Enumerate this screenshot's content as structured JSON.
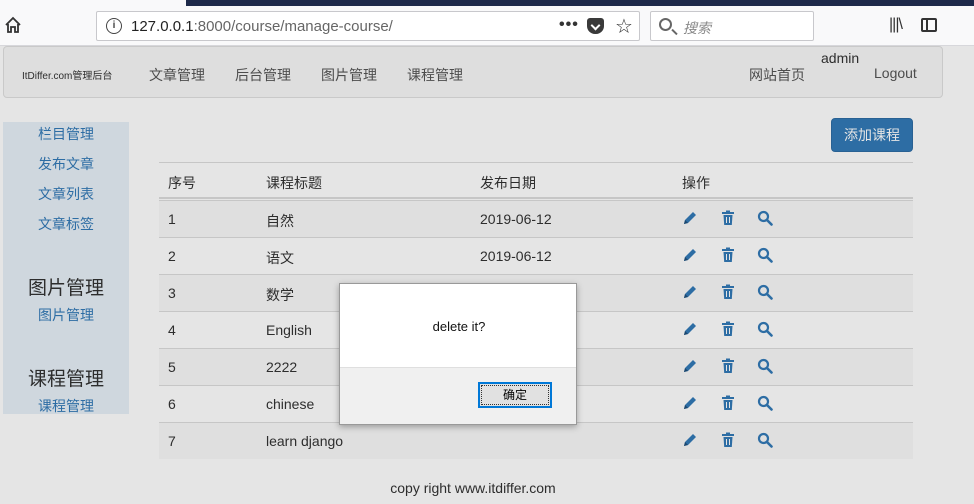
{
  "browser": {
    "url_host": "127.0.0.1",
    "url_rest": ":8000/course/manage-course/",
    "search_placeholder": "搜索"
  },
  "navbar": {
    "brand": "ItDiffer.com管理后台",
    "links": [
      "文章管理",
      "后台管理",
      "图片管理",
      "课程管理"
    ],
    "home": "网站首页",
    "user": "admin",
    "logout": "Logout"
  },
  "sidebar": {
    "items": [
      "栏目管理",
      "发布文章",
      "文章列表",
      "文章标签"
    ],
    "sections": [
      {
        "heading": "图片管理",
        "items": [
          "图片管理"
        ]
      },
      {
        "heading": "课程管理",
        "items": [
          "课程管理"
        ]
      }
    ]
  },
  "main": {
    "add_button": "添加课程",
    "table": {
      "headers": [
        "序号",
        "课程标题",
        "发布日期",
        "操作"
      ],
      "rows": [
        {
          "id": "1",
          "title": "自然",
          "date": "2019-06-12"
        },
        {
          "id": "2",
          "title": "语文",
          "date": "2019-06-12"
        },
        {
          "id": "3",
          "title": "数学",
          "date": ""
        },
        {
          "id": "4",
          "title": "English",
          "date": ""
        },
        {
          "id": "5",
          "title": "2222",
          "date": ""
        },
        {
          "id": "6",
          "title": "chinese",
          "date": ""
        },
        {
          "id": "7",
          "title": "learn django",
          "date": ""
        }
      ]
    }
  },
  "footer": {
    "text": "copy right www.itdiffer.com"
  },
  "dialog": {
    "message": "delete it?",
    "ok_label": "确定"
  },
  "colors": {
    "accent": "#337ab7",
    "icon": "#337ab7"
  }
}
